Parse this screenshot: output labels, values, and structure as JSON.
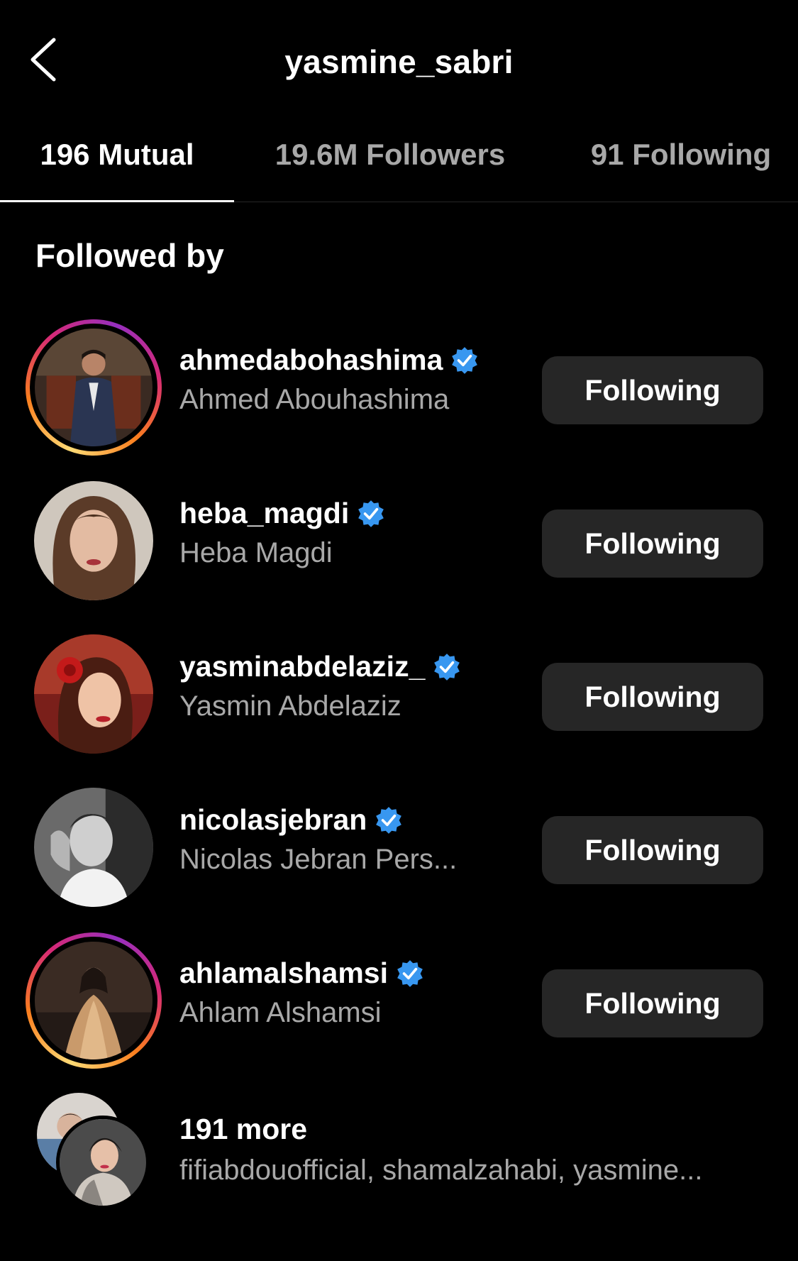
{
  "header": {
    "title": "yasmine_sabri",
    "back_icon": "chevron-left-icon"
  },
  "tabs": [
    {
      "label": "196 Mutual",
      "active": true
    },
    {
      "label": "19.6M Followers",
      "active": false
    },
    {
      "label": "91 Following",
      "active": false
    }
  ],
  "section": {
    "title": "Followed by"
  },
  "users": [
    {
      "username": "ahmedabohashima",
      "full_name": "Ahmed Abouhashima",
      "verified": true,
      "story_ring": true,
      "button": "Following"
    },
    {
      "username": "heba_magdi",
      "full_name": "Heba Magdi",
      "verified": true,
      "story_ring": false,
      "button": "Following"
    },
    {
      "username": "yasminabdelaziz_",
      "full_name": "Yasmin Abdelaziz",
      "verified": true,
      "story_ring": false,
      "button": "Following"
    },
    {
      "username": "nicolasjebran",
      "full_name": "Nicolas Jebran Pers...",
      "verified": true,
      "story_ring": false,
      "button": "Following"
    },
    {
      "username": "ahlamalshamsi",
      "full_name": "Ahlam Alshamsi",
      "verified": true,
      "story_ring": true,
      "button": "Following"
    }
  ],
  "more": {
    "title": "191 more",
    "subtitle": "fifiabdouofficial, shamalzahabi, yasmine..."
  },
  "colors": {
    "background": "#000000",
    "button_bg": "#262626",
    "secondary_text": "#a8a8a8",
    "verified_blue": "#3897f0"
  }
}
